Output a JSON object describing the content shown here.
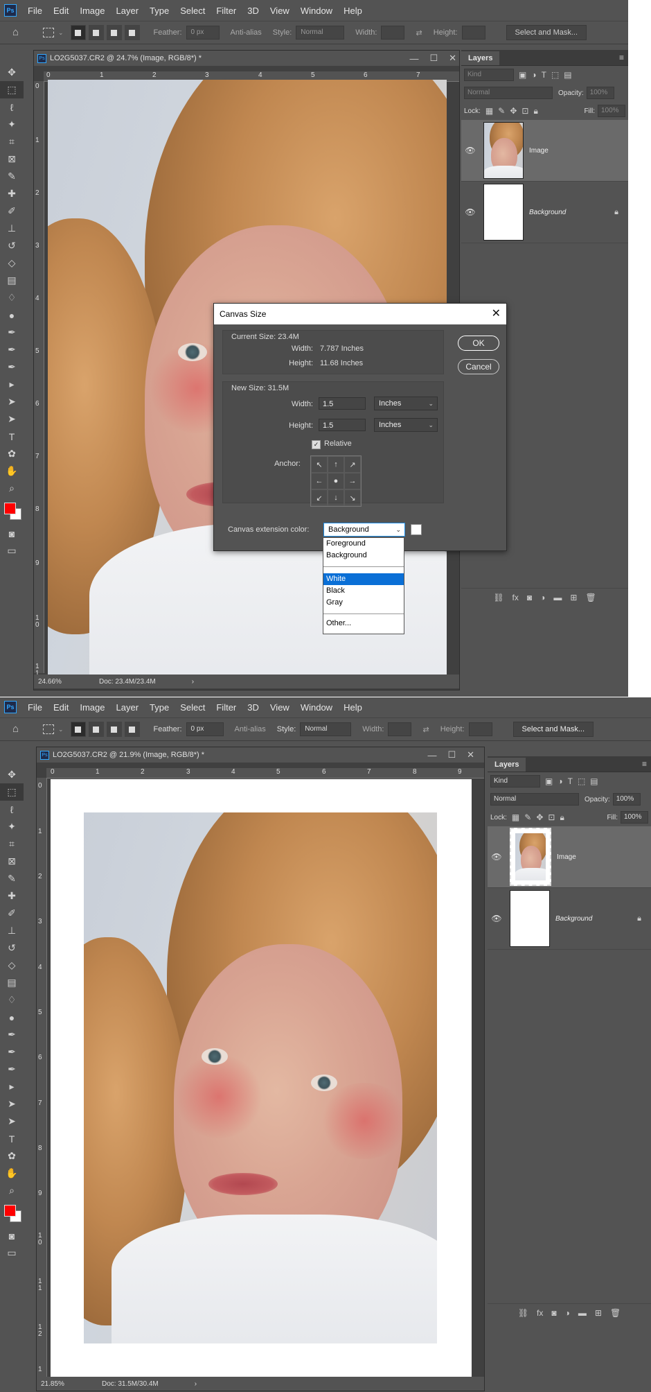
{
  "menus": [
    "File",
    "Edit",
    "Image",
    "Layer",
    "Type",
    "Select",
    "Filter",
    "3D",
    "View",
    "Window",
    "Help"
  ],
  "logo": "Ps",
  "shot1": {
    "options": {
      "feather_label": "Feather:",
      "feather_value": "0 px",
      "antialias": "Anti-alias",
      "style_label": "Style:",
      "style_value": "Normal",
      "width_label": "Width:",
      "height_label": "Height:",
      "select_mask": "Select and Mask..."
    },
    "doc_title": "LO2G5037.CR2 @ 24.7% (Image, RGB/8*) *",
    "ruler_h": [
      "0",
      "1",
      "2",
      "3",
      "4",
      "5",
      "6",
      "7"
    ],
    "ruler_v": [
      "0",
      "1",
      "2",
      "3",
      "4",
      "5",
      "6",
      "7",
      "8",
      "9",
      "1\n0",
      "1\n1"
    ],
    "zoom": "24.66%",
    "docsize": "Doc: 23.4M/23.4M",
    "layers": {
      "tab": "Layers",
      "kind": "Kind",
      "blend": "Normal",
      "opacity_label": "Opacity:",
      "opacity_value": "100%",
      "lock_label": "Lock:",
      "fill_label": "Fill:",
      "fill_value": "100%",
      "items": [
        {
          "name": "Image"
        },
        {
          "name": "Background"
        }
      ]
    },
    "dialog": {
      "title": "Canvas Size",
      "current_size": "Current Size: 23.4M",
      "width_label": "Width:",
      "width_value": "7.787 Inches",
      "height_label": "Height:",
      "height_value": "11.68 Inches",
      "new_size": "New Size: 31.5M",
      "new_width": "1.5",
      "new_height": "1.5",
      "unit": "Inches",
      "relative": "Relative",
      "anchor_label": "Anchor:",
      "ext_label": "Canvas extension color:",
      "ext_value": "Background",
      "ok": "OK",
      "cancel": "Cancel",
      "options_a": [
        "Foreground",
        "Background"
      ],
      "options_b": [
        "White",
        "Black",
        "Gray"
      ],
      "options_c": [
        "Other..."
      ]
    }
  },
  "shot2": {
    "options": {
      "feather_label": "Feather:",
      "feather_value": "0 px",
      "antialias": "Anti-alias",
      "style_label": "Style:",
      "style_value": "Normal",
      "width_label": "Width:",
      "height_label": "Height:",
      "select_mask": "Select and Mask..."
    },
    "doc_title": "LO2G5037.CR2 @ 21.9% (Image, RGB/8*) *",
    "ruler_h": [
      "0",
      "1",
      "2",
      "3",
      "4",
      "5",
      "6",
      "7",
      "8",
      "9"
    ],
    "ruler_v": [
      "0",
      "1",
      "2",
      "3",
      "4",
      "5",
      "6",
      "7",
      "8",
      "9",
      "1\n0",
      "1\n1",
      "1\n2",
      "1"
    ],
    "zoom": "21.85%",
    "docsize": "Doc: 31.5M/30.4M",
    "layers": {
      "tab": "Layers",
      "kind": "Kind",
      "blend": "Normal",
      "opacity_label": "Opacity:",
      "opacity_value": "100%",
      "lock_label": "Lock:",
      "fill_label": "Fill:",
      "fill_value": "100%",
      "items": [
        {
          "name": "Image"
        },
        {
          "name": "Background"
        }
      ]
    }
  }
}
